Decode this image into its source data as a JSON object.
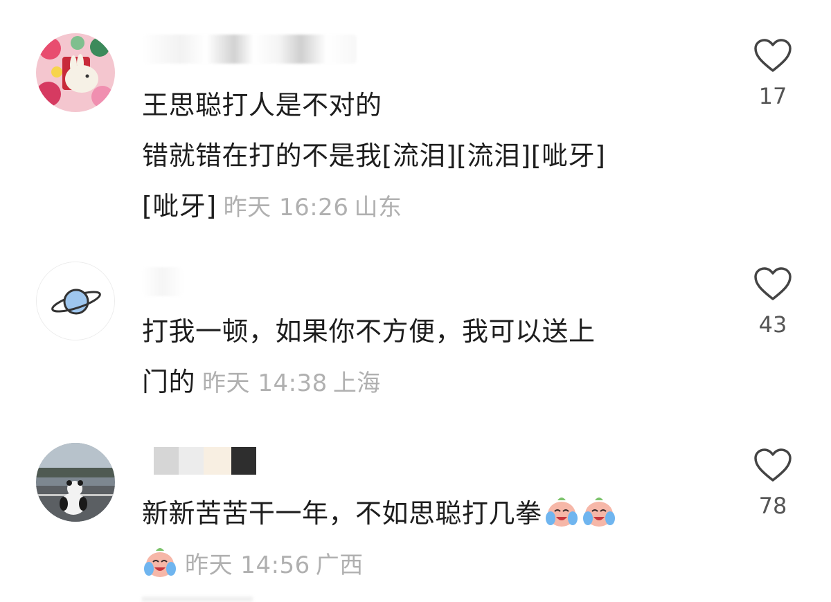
{
  "comments": [
    {
      "text_lines": [
        "王思聪打人是不对的",
        "错就错在打的不是我[流泪][流泪][呲牙]",
        "[呲牙]"
      ],
      "time": "昨天 16:26",
      "location": "山东",
      "likes": "17",
      "avatar": "rabbit-floral-avatar"
    },
    {
      "text_lines": [
        "打我一顿，如果你不方便，我可以送上",
        "门的"
      ],
      "time": "昨天 14:38",
      "location": "上海",
      "likes": "43",
      "avatar": "planet-avatar"
    },
    {
      "text_lines": [
        "新新苦苦干一年，不如思聪打几拳"
      ],
      "time": "昨天 14:56",
      "location": "广西",
      "likes": "78",
      "avatar": "panda-road-avatar",
      "emoji": "crying-laughing-emoji"
    }
  ],
  "colors": {
    "text": "#1d1d1d",
    "meta": "#b0b0b0",
    "count": "#555555",
    "icon": "#444444"
  },
  "icons": {
    "like": "heart-outline-icon"
  }
}
